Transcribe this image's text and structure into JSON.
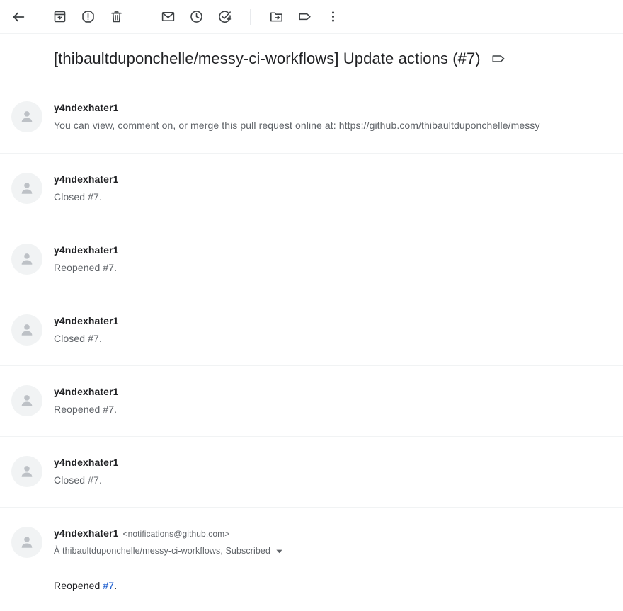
{
  "toolbar": {
    "back_label": "Back",
    "actions": [
      {
        "name": "back-button",
        "icon": "back-arrow-icon",
        "label": "Retour"
      },
      {
        "name": "archive-button",
        "icon": "archive-icon",
        "label": "Archiver"
      },
      {
        "name": "report-spam-button",
        "icon": "report-spam-icon",
        "label": "Signaler comme spam"
      },
      {
        "name": "delete-button",
        "icon": "trash-icon",
        "label": "Supprimer"
      },
      {
        "name": "mark-unread-button",
        "icon": "envelope-icon",
        "label": "Marquer comme non lu"
      },
      {
        "name": "snooze-button",
        "icon": "clock-icon",
        "label": "Différer"
      },
      {
        "name": "add-to-tasks-button",
        "icon": "add-task-icon",
        "label": "Ajouter aux tâches"
      },
      {
        "name": "move-to-button",
        "icon": "move-to-folder-icon",
        "label": "Déplacer vers"
      },
      {
        "name": "labels-button",
        "icon": "label-tag-icon",
        "label": "Libellés"
      },
      {
        "name": "more-button",
        "icon": "more-vertical-icon",
        "label": "Plus"
      }
    ]
  },
  "subject": {
    "title": "[thibaultduponchelle/messy-ci-workflows] Update actions (#7)",
    "label_icon": "label-tag-icon"
  },
  "thread": {
    "messages": [
      {
        "sender": "y4ndexhater1",
        "snippet": "You can view, comment on, or merge this pull request online at: https://github.com/thibaultduponchelle/messy",
        "expanded": false
      },
      {
        "sender": "y4ndexhater1",
        "snippet": "Closed #7.",
        "expanded": false
      },
      {
        "sender": "y4ndexhater1",
        "snippet": "Reopened #7.",
        "expanded": false
      },
      {
        "sender": "y4ndexhater1",
        "snippet": "Closed #7.",
        "expanded": false
      },
      {
        "sender": "y4ndexhater1",
        "snippet": "Reopened #7.",
        "expanded": false
      },
      {
        "sender": "y4ndexhater1",
        "snippet": "Closed #7.",
        "expanded": false
      }
    ],
    "expanded_message": {
      "sender": "y4ndexhater1",
      "email": "<notifications@github.com>",
      "recipient": "À thibaultduponchelle/messy-ci-workflows, Subscribed",
      "body_prefix": "Reopened ",
      "body_link": "#7",
      "body_suffix": "."
    }
  },
  "colors": {
    "text_primary": "#202124",
    "text_secondary": "#5f6368",
    "link": "#1155cc",
    "divider": "#f1f3f4",
    "avatar_bg": "#f1f3f4",
    "avatar_fg": "#bdc1c6"
  }
}
